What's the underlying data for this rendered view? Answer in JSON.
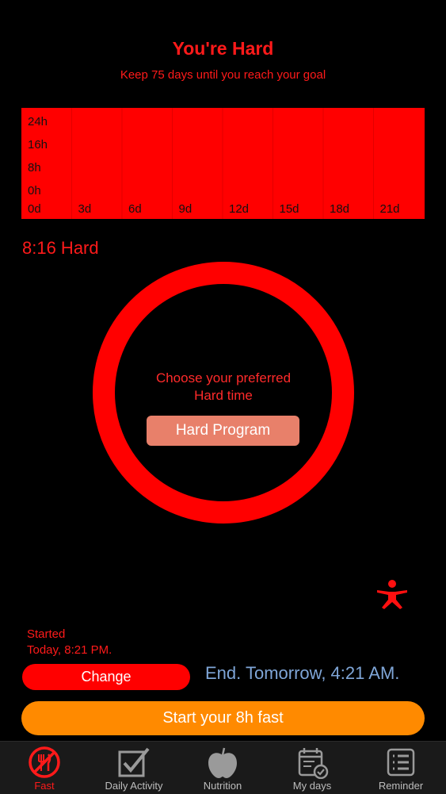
{
  "header": {
    "title": "You're Hard",
    "subtitle": "Keep 75 days until you reach your goal"
  },
  "chart_data": {
    "type": "bar",
    "y_ticks": [
      "24h",
      "16h",
      "8h",
      "0h"
    ],
    "x_ticks": [
      "0d",
      "3d",
      "6d",
      "9d",
      "12d",
      "15d",
      "18d",
      "21d"
    ],
    "ylim": [
      0,
      24
    ],
    "values": [],
    "background_color": "#ff0000"
  },
  "program": {
    "name": "8:16 Hard",
    "prompt_line1": "Choose your preferred",
    "prompt_line2": "Hard time",
    "button_label": "Hard Program"
  },
  "session": {
    "started_label": "Started",
    "started_time": "Today, 8:21 PM.",
    "change_label": "Change",
    "end_text": "End. Tomorrow, 4:21 AM.",
    "start_label": "Start your 8h fast"
  },
  "tabs": [
    {
      "label": "Fast",
      "icon": "no-food-icon",
      "active": true
    },
    {
      "label": "Daily Activity",
      "icon": "checkbox-icon",
      "active": false
    },
    {
      "label": "Nutrition",
      "icon": "apple-icon",
      "active": false
    },
    {
      "label": "My days",
      "icon": "calendar-icon",
      "active": false
    },
    {
      "label": "Reminder",
      "icon": "list-icon",
      "active": false
    }
  ],
  "colors": {
    "accent": "#ff1a1a",
    "chart_bg": "#ff0000",
    "program_button": "#e8806a",
    "end_text": "#7fa6d8",
    "start_button": "#ff8a00",
    "tabbar": "#1a1a1a"
  }
}
